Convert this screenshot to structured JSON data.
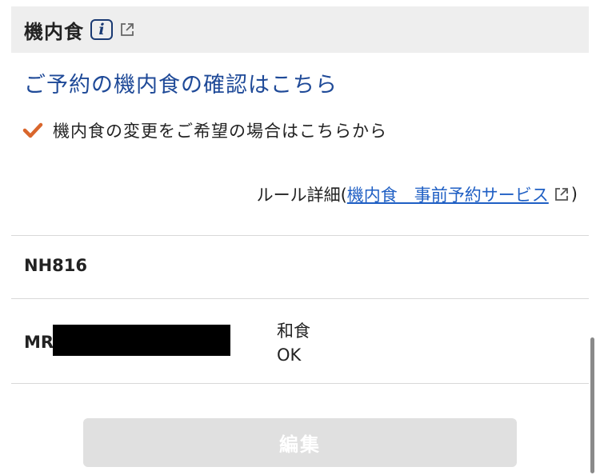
{
  "section": {
    "title": "機内食",
    "info_icon": "info-icon",
    "external_icon": "external-link-icon"
  },
  "confirm_link": "ご予約の機内食の確認はこちら",
  "change": {
    "icon": "checkmark-icon",
    "text": "機内食の変更をご希望の場合はこちらから"
  },
  "rules": {
    "prefix": "ルール詳細(",
    "link": "機内食　事前予約サービス",
    "suffix": ")"
  },
  "flight": {
    "number": "NH816"
  },
  "passenger": {
    "title": "MR",
    "meal_type": "和食",
    "meal_status": "OK"
  },
  "edit_button": {
    "label": "編集",
    "enabled": false
  },
  "colors": {
    "link_dark": "#1f4a98",
    "link": "#1f5fc4",
    "check": "#d9662c",
    "header_bg": "#eeeeee",
    "disabled_button": "#e0e0e0"
  }
}
